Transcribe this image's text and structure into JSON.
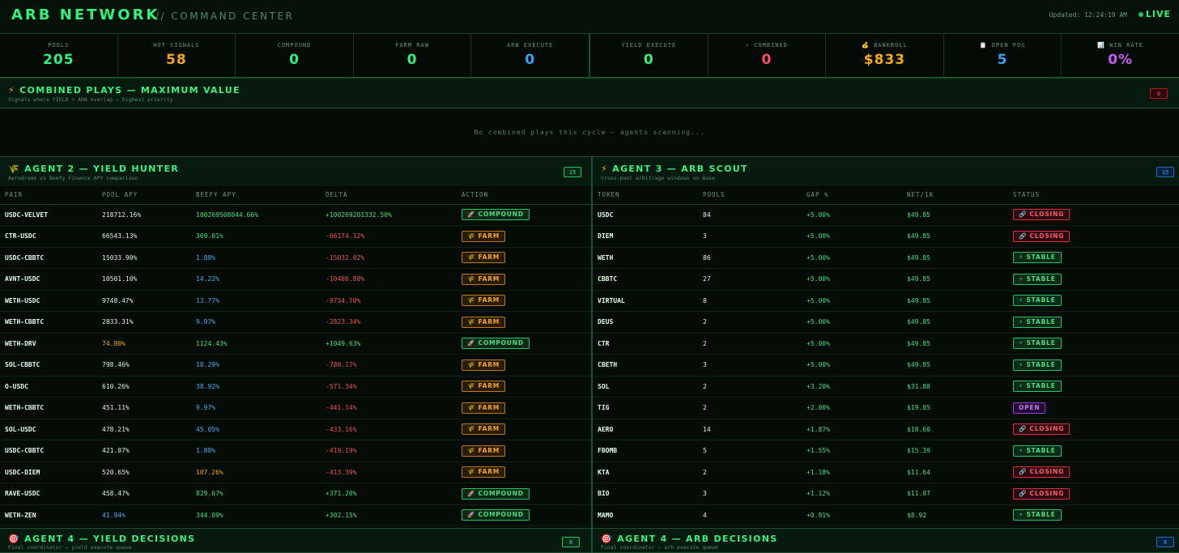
{
  "header": {
    "title": "ARB NETWORK",
    "subtitle": "// COMMAND CENTER",
    "updated": "Updated: 12:24:19 AM",
    "live": "LIVE"
  },
  "stats": [
    {
      "icon": "",
      "label": "POOLS",
      "value": "205",
      "color": "#35f07c"
    },
    {
      "icon": "",
      "label": "HOT SIGNALS",
      "value": "58",
      "color": "#f5a623"
    },
    {
      "icon": "",
      "label": "COMPOUND",
      "value": "0",
      "color": "#35f07c"
    },
    {
      "icon": "",
      "label": "FARM RAW",
      "value": "0",
      "color": "#35f07c"
    },
    {
      "icon": "",
      "label": "ARB EXECUTE",
      "value": "0",
      "color": "#38a3f5"
    },
    {
      "icon": "",
      "label": "YIELD EXECUTE",
      "value": "0",
      "color": "#35f07c"
    },
    {
      "icon": "⚡",
      "label": "COMBINED",
      "value": "0",
      "color": "#ff4d5e"
    },
    {
      "icon": "💰",
      "label": "BANKROLL",
      "value": "$833",
      "color": "#f5a623"
    },
    {
      "icon": "📋",
      "label": "OPEN POS",
      "value": "5",
      "color": "#38a3f5"
    },
    {
      "icon": "📊",
      "label": "WIN RATE",
      "value": "0%",
      "color": "#c65cf5"
    }
  ],
  "combined": {
    "icon": "⚡",
    "title": "COMBINED PLAYS — MAXIMUM VALUE",
    "subtitle": "Signals where YIELD + ARB overlap — highest priority",
    "count": "0",
    "empty": "No combined plays this cycle — agents scanning..."
  },
  "yield": {
    "icon": "🌾",
    "title": "AGENT 2 — YIELD HUNTER",
    "subtitle": "Aerodrome vs Beefy Finance APY comparison",
    "count": "15",
    "columns": [
      "PAIR",
      "POOL APY",
      "BEEFY APY",
      "DELTA",
      "ACTION"
    ],
    "rows": [
      {
        "pair": "USDC-VELVET",
        "pool": "218712.16%",
        "pool_c": "white",
        "beefy": "100269508044.66%",
        "beefy_c": "green",
        "delta": "+100269201332.50%",
        "delta_c": "green",
        "action": "🚀 COMPOUND",
        "kind": "compound"
      },
      {
        "pair": "CTR-USDC",
        "pool": "66543.13%",
        "pool_c": "white",
        "beefy": "369.01%",
        "beefy_c": "green",
        "delta": "-66174.12%",
        "delta_c": "red",
        "action": "🌾 FARM",
        "kind": "farm"
      },
      {
        "pair": "USDC-CBBTC",
        "pool": "15033.90%",
        "pool_c": "white",
        "beefy": "1.88%",
        "beefy_c": "blue",
        "delta": "-15032.02%",
        "delta_c": "red",
        "action": "🌾 FARM",
        "kind": "farm"
      },
      {
        "pair": "AVNT-USDC",
        "pool": "10501.10%",
        "pool_c": "white",
        "beefy": "14.22%",
        "beefy_c": "blue",
        "delta": "-10486.88%",
        "delta_c": "red",
        "action": "🌾 FARM",
        "kind": "farm"
      },
      {
        "pair": "WETH-USDC",
        "pool": "9748.47%",
        "pool_c": "white",
        "beefy": "13.77%",
        "beefy_c": "blue",
        "delta": "-9734.70%",
        "delta_c": "red",
        "action": "🌾 FARM",
        "kind": "farm"
      },
      {
        "pair": "WETH-CBBTC",
        "pool": "2833.31%",
        "pool_c": "white",
        "beefy": "9.97%",
        "beefy_c": "blue",
        "delta": "-2823.34%",
        "delta_c": "red",
        "action": "🌾 FARM",
        "kind": "farm"
      },
      {
        "pair": "WETH-DRV",
        "pool": "74.80%",
        "pool_c": "amber",
        "beefy": "1124.43%",
        "beefy_c": "green",
        "delta": "+1049.63%",
        "delta_c": "green",
        "action": "🚀 COMPOUND",
        "kind": "compound"
      },
      {
        "pair": "SOL-CBBTC",
        "pool": "798.46%",
        "pool_c": "white",
        "beefy": "18.29%",
        "beefy_c": "blue",
        "delta": "-780.17%",
        "delta_c": "red",
        "action": "🌾 FARM",
        "kind": "farm"
      },
      {
        "pair": "O-USDC",
        "pool": "610.26%",
        "pool_c": "white",
        "beefy": "38.92%",
        "beefy_c": "blue",
        "delta": "-571.34%",
        "delta_c": "red",
        "action": "🌾 FARM",
        "kind": "farm"
      },
      {
        "pair": "WETH-CBBTC",
        "pool": "451.11%",
        "pool_c": "white",
        "beefy": "9.97%",
        "beefy_c": "blue",
        "delta": "-441.14%",
        "delta_c": "red",
        "action": "🌾 FARM",
        "kind": "farm"
      },
      {
        "pair": "SOL-USDC",
        "pool": "478.21%",
        "pool_c": "white",
        "beefy": "45.05%",
        "beefy_c": "blue",
        "delta": "-433.16%",
        "delta_c": "red",
        "action": "🌾 FARM",
        "kind": "farm"
      },
      {
        "pair": "USDC-CBBTC",
        "pool": "421.07%",
        "pool_c": "white",
        "beefy": "1.88%",
        "beefy_c": "blue",
        "delta": "-419.19%",
        "delta_c": "red",
        "action": "🌾 FARM",
        "kind": "farm"
      },
      {
        "pair": "USDC-DIEM",
        "pool": "520.65%",
        "pool_c": "white",
        "beefy": "107.26%",
        "beefy_c": "amber",
        "delta": "-413.39%",
        "delta_c": "red",
        "action": "🌾 FARM",
        "kind": "farm"
      },
      {
        "pair": "RAVE-USDC",
        "pool": "458.47%",
        "pool_c": "white",
        "beefy": "829.67%",
        "beefy_c": "green",
        "delta": "+371.20%",
        "delta_c": "green",
        "action": "🚀 COMPOUND",
        "kind": "compound"
      },
      {
        "pair": "WETH-ZEN",
        "pool": "41.94%",
        "pool_c": "blue",
        "beefy": "344.09%",
        "beefy_c": "green",
        "delta": "+302.15%",
        "delta_c": "green",
        "action": "🚀 COMPOUND",
        "kind": "compound"
      }
    ]
  },
  "arb": {
    "icon": "⚡",
    "title": "AGENT 3 — ARB SCOUT",
    "subtitle": "Cross-pool arbitrage windows on Base",
    "count": "15",
    "columns": [
      "TOKEN",
      "POOLS",
      "GAP %",
      "NET/1K",
      "STATUS"
    ],
    "rows": [
      {
        "token": "USDC",
        "pools": "84",
        "gap": "+5.00%",
        "net": "$49.85",
        "status": "🔗 CLOSING",
        "kind": "closing"
      },
      {
        "token": "DIEM",
        "pools": "3",
        "gap": "+5.00%",
        "net": "$49.85",
        "status": "🔗 CLOSING",
        "kind": "closing"
      },
      {
        "token": "WETH",
        "pools": "86",
        "gap": "+5.00%",
        "net": "$49.85",
        "status": "⚡ STABLE",
        "kind": "stable"
      },
      {
        "token": "CBBTC",
        "pools": "27",
        "gap": "+5.00%",
        "net": "$49.85",
        "status": "⚡ STABLE",
        "kind": "stable"
      },
      {
        "token": "VIRTUAL",
        "pools": "8",
        "gap": "+5.00%",
        "net": "$49.85",
        "status": "⚡ STABLE",
        "kind": "stable"
      },
      {
        "token": "DEUS",
        "pools": "2",
        "gap": "+5.00%",
        "net": "$49.85",
        "status": "⚡ STABLE",
        "kind": "stable"
      },
      {
        "token": "CTR",
        "pools": "2",
        "gap": "+5.00%",
        "net": "$49.85",
        "status": "⚡ STABLE",
        "kind": "stable"
      },
      {
        "token": "CBETH",
        "pools": "3",
        "gap": "+5.00%",
        "net": "$49.85",
        "status": "⚡ STABLE",
        "kind": "stable"
      },
      {
        "token": "SOL",
        "pools": "2",
        "gap": "+3.20%",
        "net": "$31.88",
        "status": "⚡ STABLE",
        "kind": "stable"
      },
      {
        "token": "TIG",
        "pools": "2",
        "gap": "+2.00%",
        "net": "$19.85",
        "status": "OPEN",
        "kind": "open"
      },
      {
        "token": "AERO",
        "pools": "14",
        "gap": "+1.87%",
        "net": "$18.60",
        "status": "🔗 CLOSING",
        "kind": "closing"
      },
      {
        "token": "FBOMB",
        "pools": "5",
        "gap": "+1.55%",
        "net": "$15.39",
        "status": "⚡ STABLE",
        "kind": "stable"
      },
      {
        "token": "KTA",
        "pools": "2",
        "gap": "+1.18%",
        "net": "$11.64",
        "status": "🔗 CLOSING",
        "kind": "closing"
      },
      {
        "token": "BIO",
        "pools": "3",
        "gap": "+1.12%",
        "net": "$11.07",
        "status": "🔗 CLOSING",
        "kind": "closing"
      },
      {
        "token": "MAMO",
        "pools": "4",
        "gap": "+0.91%",
        "net": "$8.92",
        "status": "⚡ STABLE",
        "kind": "stable"
      }
    ]
  },
  "yield_decisions": {
    "icon": "🎯",
    "title": "AGENT 4 — YIELD DECISIONS",
    "subtitle": "Final coordinator — yield execute queue",
    "count": "8"
  },
  "arb_decisions": {
    "icon": "🎯",
    "title": "AGENT 4 — ARB DECISIONS",
    "subtitle": "Final coordinator — arb execute queue",
    "count": "8"
  },
  "colors": {
    "accent": "#35f07c",
    "background": "#050c07",
    "danger": "#f05454",
    "warning": "#f5a623",
    "info": "#4fa8f0"
  }
}
